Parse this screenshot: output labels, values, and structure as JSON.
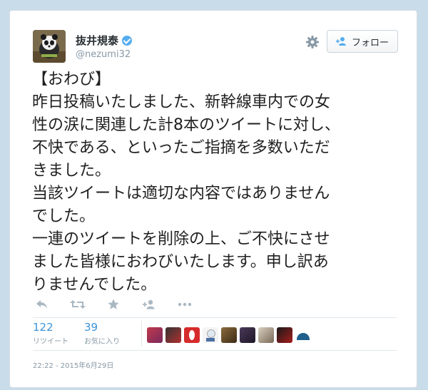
{
  "user": {
    "display_name": "抜井規泰",
    "handle": "@nezumi32",
    "verified": true
  },
  "follow_button": {
    "label": "フォロー"
  },
  "tweet": {
    "text": "【おわび】\n昨日投稿いたしました、新幹線車内での女\n性の涙に関連した計8本のツイートに対し、\n不快である、といったご指摘を多数いただ\nきました。\n当該ツイートは適切な内容ではありません\nでした。\n一連のツイートを削除の上、ご不快にさせ\nました皆様におわびいたします。申し訳あ\nりませんでした。"
  },
  "actions": [
    "reply-icon",
    "retweet-icon",
    "favorite-icon",
    "follow-icon",
    "more-icon"
  ],
  "stats": {
    "retweets": {
      "value": "122",
      "label": "リツイート"
    },
    "favorites": {
      "value": "39",
      "label": "お気に入り"
    }
  },
  "favorited_by_count": 9,
  "timestamp": "22:22 - 2015年6月29日",
  "colors": {
    "accent": "#3b94d9",
    "verified": "#55acee",
    "muted": "#8899a6",
    "page_background": "#c9dcea"
  }
}
